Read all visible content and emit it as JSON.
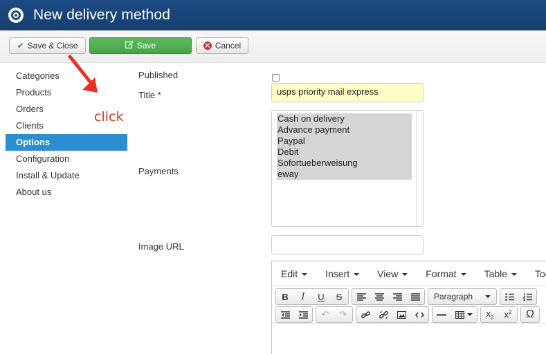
{
  "header": {
    "title": "New delivery method"
  },
  "toolbar": {
    "save_close_label": "Save & Close",
    "save_label": "Save",
    "cancel_label": "Cancel"
  },
  "sidebar": {
    "items": [
      {
        "label": "Categories"
      },
      {
        "label": "Products"
      },
      {
        "label": "Orders"
      },
      {
        "label": "Clients"
      },
      {
        "label": "Options",
        "active": true
      },
      {
        "label": "Configuration"
      },
      {
        "label": "Install & Update"
      },
      {
        "label": "About us"
      }
    ]
  },
  "annotation": {
    "text": "click",
    "color": "#e53228"
  },
  "form": {
    "published_label": "Published",
    "published_checked": false,
    "title_label": "Title *",
    "title_value": "usps priority mail express",
    "payments_label": "Payments",
    "payments_options": [
      "Cash on delivery",
      "Advance payment",
      "Paypal",
      "Debit",
      "Sofortueberweisung",
      "eway"
    ],
    "image_url_label": "Image URL",
    "image_url_value": ""
  },
  "editor": {
    "menus": [
      "Edit",
      "Insert",
      "View",
      "Format",
      "Table",
      "Too"
    ],
    "format_select": "Paragraph"
  },
  "colors": {
    "header_bg": "#1c4a83",
    "active_item_bg": "#2a8ed0",
    "save_button_bg": "#46a546",
    "title_input_bg": "#ffffc6"
  }
}
